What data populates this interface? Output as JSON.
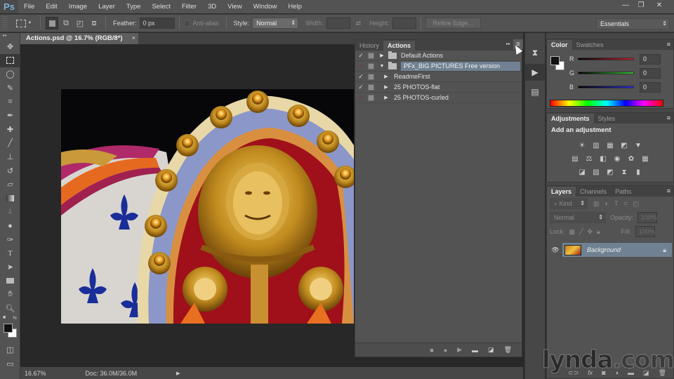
{
  "app": {
    "logo": "Ps"
  },
  "menubar": {
    "items": [
      "File",
      "Edit",
      "Image",
      "Layer",
      "Type",
      "Select",
      "Filter",
      "3D",
      "View",
      "Window",
      "Help"
    ],
    "window_controls": {
      "minimize": "—",
      "restore": "❐",
      "close": "✕"
    }
  },
  "options_bar": {
    "feather_label": "Feather:",
    "feather_value": "0 px",
    "antialias_label": "Anti-alias",
    "style_label": "Style:",
    "style_value": "Normal",
    "width_label": "Width:",
    "height_label": "Height:",
    "refine_edge_label": "Refine Edge...",
    "workspace_value": "Essentials"
  },
  "document": {
    "tab_title": "Actions.psd @ 16.7% (RGB/8*)",
    "close": "×",
    "zoom_level": "16.67%",
    "doc_size": "Doc: 36.0M/36.0M",
    "status_arrow": "▶"
  },
  "actions_panel": {
    "tabs": [
      {
        "label": "History",
        "active": false
      },
      {
        "label": "Actions",
        "active": true
      }
    ],
    "menu_icon": "≡",
    "collapse_icon": "▸▸",
    "rows": [
      {
        "check": "✓",
        "check_color": "normal",
        "expand": "▶",
        "is_set": true,
        "name": "Default Actions",
        "selected": false,
        "indent": 0
      },
      {
        "check": "✓",
        "check_color": "red",
        "expand": "▼",
        "is_set": true,
        "name": "PFx_BIG PICTURES Free version",
        "selected": true,
        "indent": 0
      },
      {
        "check": "✓",
        "check_color": "normal",
        "expand": "▶",
        "is_set": false,
        "name": "ReadmeFirst",
        "selected": false,
        "indent": 1
      },
      {
        "check": "✓",
        "check_color": "normal",
        "expand": "▶",
        "is_set": false,
        "name": "25 PHOTOS-flat",
        "selected": false,
        "indent": 1
      },
      {
        "check": "✓",
        "check_color": "red",
        "expand": "▶",
        "is_set": false,
        "name": "25 PHOTOS-curled",
        "selected": false,
        "indent": 1
      }
    ],
    "footer_buttons": [
      "stop",
      "record",
      "play",
      "new-set",
      "new-action",
      "delete"
    ]
  },
  "color_panel": {
    "tabs": [
      {
        "label": "Color",
        "active": true
      },
      {
        "label": "Swatches",
        "active": false
      }
    ],
    "channels": [
      {
        "label": "R",
        "value": "0",
        "color": "#c8202a"
      },
      {
        "label": "G",
        "value": "0",
        "color": "#2ec82e"
      },
      {
        "label": "B",
        "value": "0",
        "color": "#2a2ad8"
      }
    ],
    "foreground": "#111111",
    "background": "#ffffff"
  },
  "adjustments_panel": {
    "tabs": [
      {
        "label": "Adjustments",
        "active": true
      },
      {
        "label": "Styles",
        "active": false
      }
    ],
    "title": "Add an adjustment",
    "rows": [
      [
        "brightness-contrast",
        "levels",
        "curves",
        "exposure",
        "vibrance"
      ],
      [
        "hue-saturation",
        "color-balance",
        "black-white",
        "photo-filter",
        "channel-mixer",
        "color-lookup"
      ],
      [
        "invert",
        "posterize",
        "threshold",
        "selective-color",
        "gradient-map"
      ]
    ]
  },
  "layers_panel": {
    "tabs": [
      {
        "label": "Layers",
        "active": true
      },
      {
        "label": "Channels",
        "active": false
      },
      {
        "label": "Paths",
        "active": false
      }
    ],
    "filter_kind": "Kind",
    "blend_mode": "Normal",
    "opacity_label": "Opacity:",
    "opacity_value": "100%",
    "lock_label": "Lock:",
    "fill_label": "Fill:",
    "fill_value": "100%",
    "layers": [
      {
        "name": "Background",
        "visible": true,
        "locked": true
      }
    ],
    "footer_buttons": [
      "link",
      "fx",
      "mask",
      "adjustment",
      "group",
      "new-layer",
      "delete"
    ]
  },
  "watermark": {
    "text_main": "lynda",
    "text_dot": ".",
    "text_tail": "com"
  }
}
